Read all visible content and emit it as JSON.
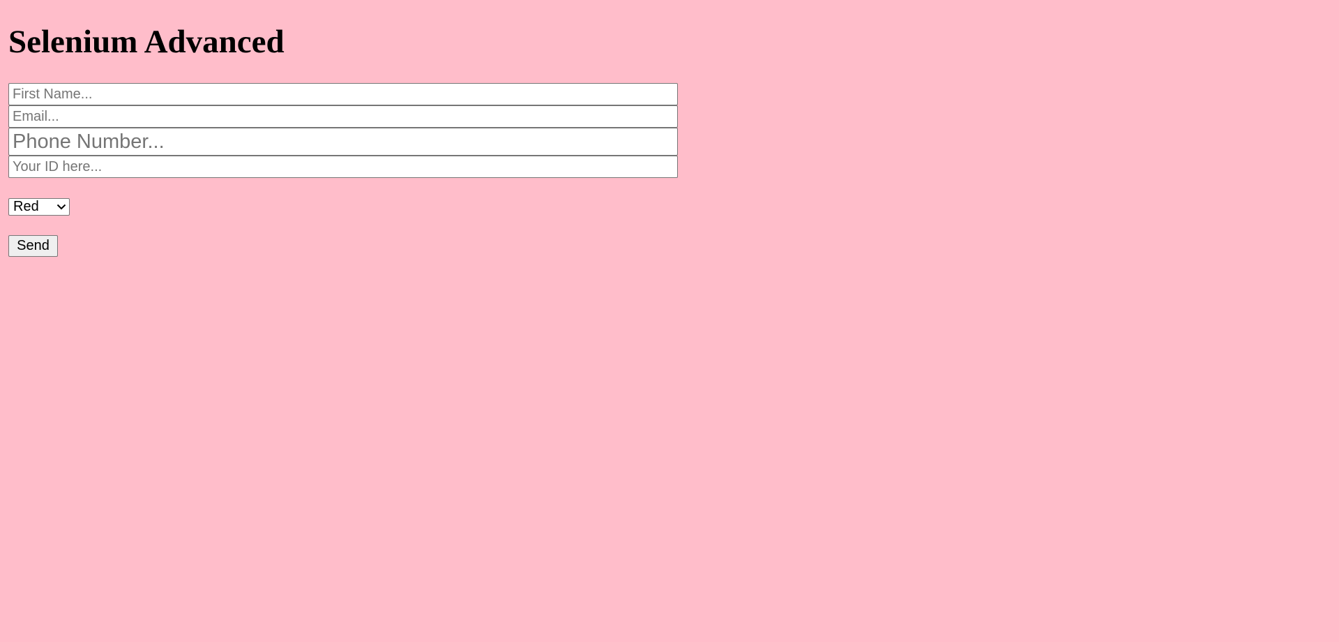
{
  "page": {
    "title": "Selenium Advanced",
    "background_color": "#ffbdca"
  },
  "form": {
    "first_name": {
      "value": "",
      "placeholder": "First Name..."
    },
    "email": {
      "value": "",
      "placeholder": "Email..."
    },
    "phone": {
      "value": "",
      "placeholder": "Phone Number..."
    },
    "user_id": {
      "value": "",
      "placeholder": "Your ID here..."
    },
    "color_select": {
      "selected": "Red",
      "icon": "chevron-down-icon"
    },
    "send_label": "Send"
  }
}
